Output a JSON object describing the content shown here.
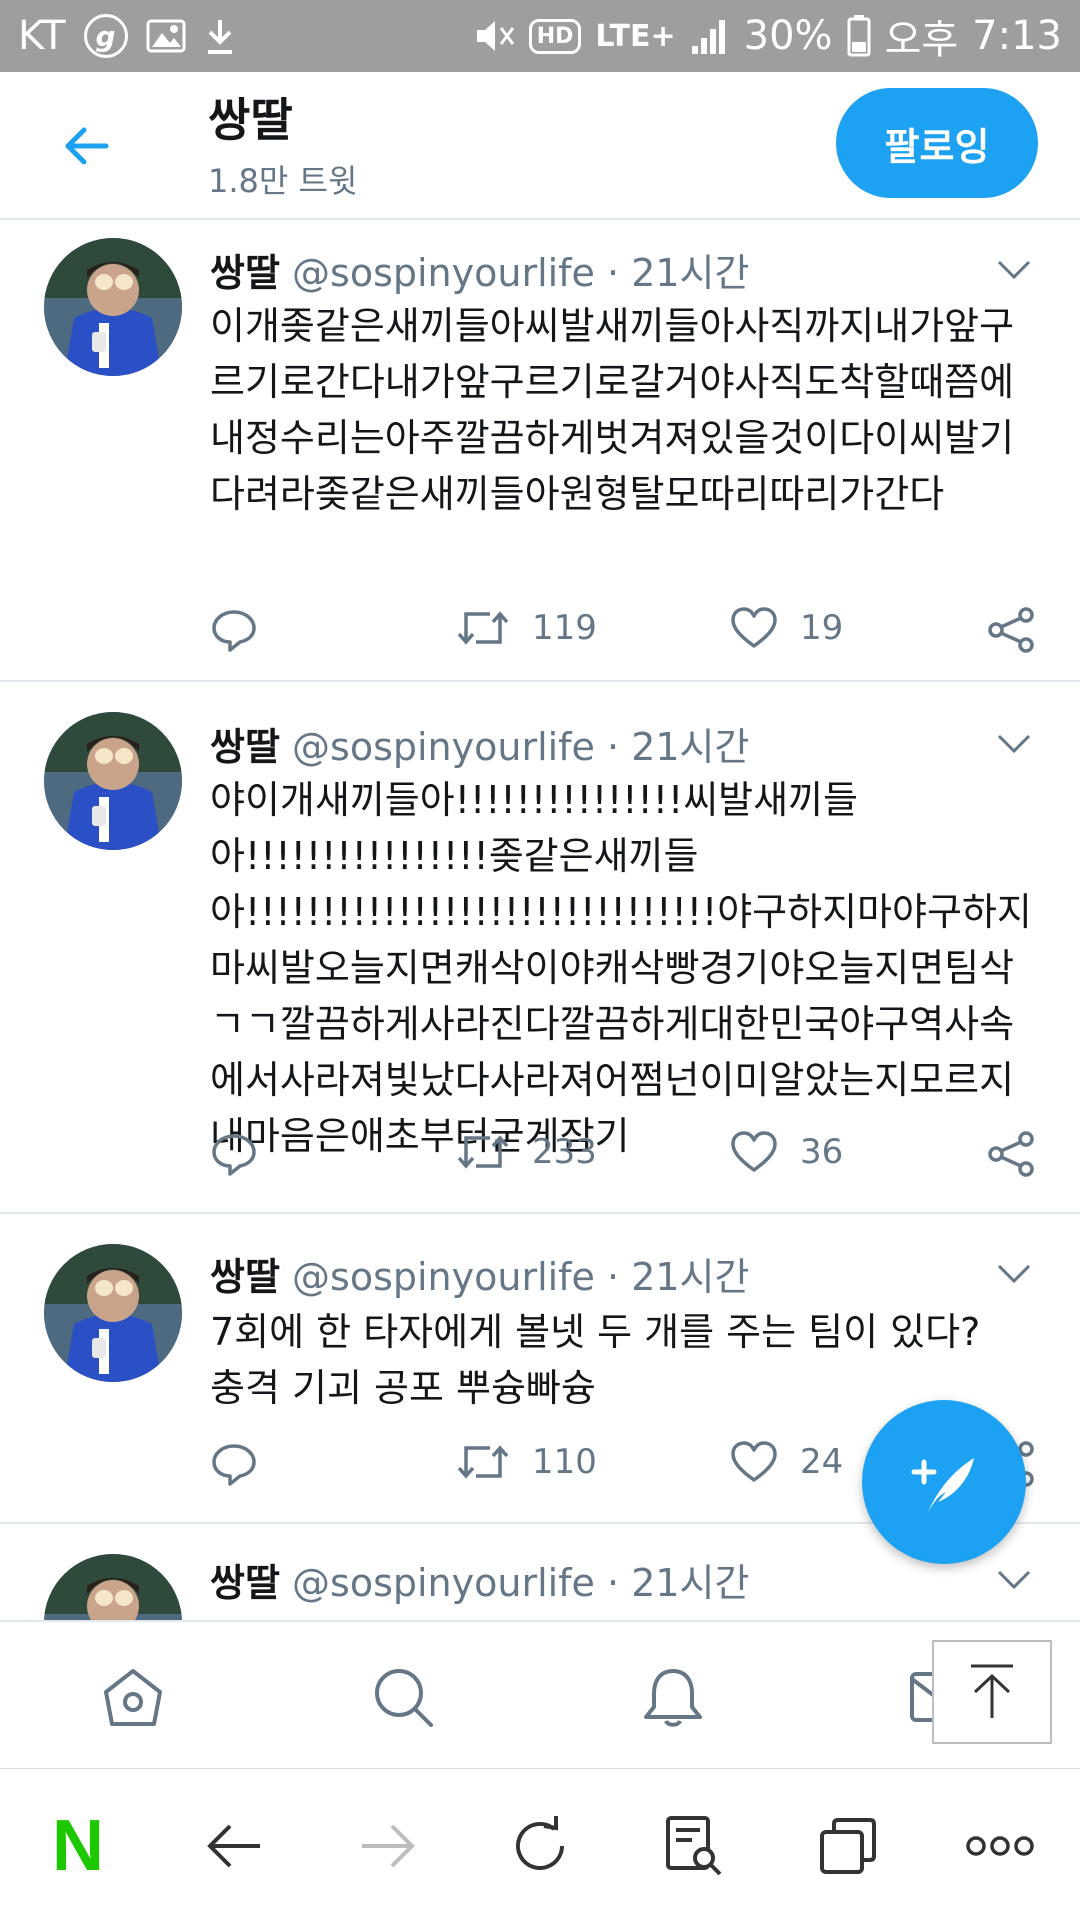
{
  "status_bar": {
    "carrier": "KT",
    "battery": "30%",
    "ampm": "오후",
    "time": "7:13",
    "network": "LTE+",
    "hd": "HD",
    "icons": [
      "g-app-icon",
      "image-icon",
      "download-icon",
      "mute-icon",
      "hd-icon",
      "lte-icon",
      "signal-icon",
      "battery-icon"
    ]
  },
  "header": {
    "title": "쌍딸",
    "subtitle": "1.8만 트윗",
    "follow_label": "팔로잉"
  },
  "tweets": [
    {
      "name": "쌍딸",
      "handle": "@sospinyourlife",
      "time": "· 21시간",
      "text": "이개좆같은새끼들아씨발새끼들아사직까지내가앞구르기로간다내가앞구르기로갈거야사직도착할때쯤에내정수리는아주깔끔하게벗겨져있을것이다이씨발기다려라좆같은새끼들아원형탈모따리따리가간다",
      "retweets": "119",
      "likes": "19"
    },
    {
      "name": "쌍딸",
      "handle": "@sospinyourlife",
      "time": "· 21시간",
      "text": "야이개새끼들아!!!!!!!!!!!!!!!씨발새끼들아!!!!!!!!!!!!!!!!좆같은새끼들아!!!!!!!!!!!!!!!!!!!!!!!!!!!!!!!야구하지마야구하지마씨발오늘지면캐삭이야캐삭빵경기야오늘지면팀삭ㄱㄱ깔끔하게사라진다깔끔하게대한민국야구역사속에서사라져빛났다사라져어쩜넌이미알았는지모르지내마음은애초부터굳게잠기",
      "retweets": "233",
      "likes": "36"
    },
    {
      "name": "쌍딸",
      "handle": "@sospinyourlife",
      "time": "· 21시간",
      "text": "7회에 한 타자에게 볼넷 두 개를 주는 팀이 있다? 충격 기괴 공포 뿌슝빠슝",
      "retweets": "110",
      "likes": "24"
    },
    {
      "name": "쌍딸",
      "handle": "@sospinyourlife",
      "time": "· 21시간"
    }
  ],
  "colors": {
    "accent": "#1da1f2",
    "text_primary": "#14171a",
    "text_secondary": "#657786",
    "divider": "#e1e8ed",
    "status_bar_bg": "#9e9e9e",
    "naver_green": "#1ec800"
  },
  "browser_bar": {
    "logo": "N"
  }
}
